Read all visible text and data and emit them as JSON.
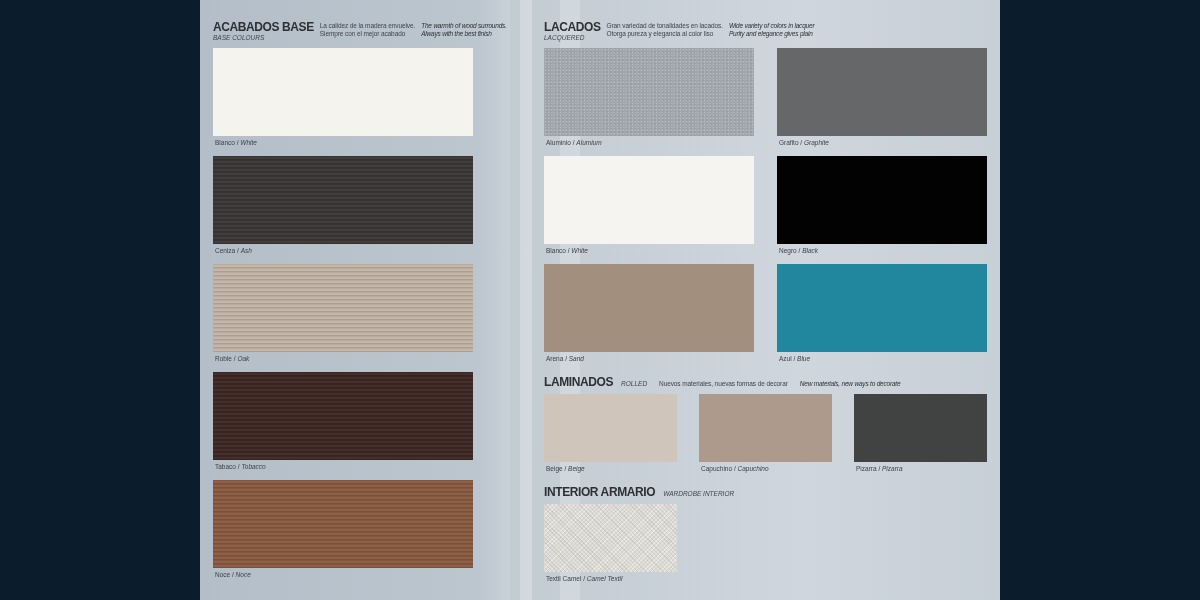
{
  "left_page": {
    "sections": [
      {
        "kind": "base",
        "title": "ACABADOS BASE",
        "subtitle": "BASE COLOURS",
        "description": [
          "La calidez de la madera envuelve.",
          "Siempre con el mejor acabado"
        ],
        "note": [
          "The warmth of wood surrounds.",
          "Always with the best finish"
        ],
        "swatches": [
          {
            "label": "Blanco / *White*",
            "kind": "solid",
            "color": "#f4f3ee"
          },
          {
            "label": "Ceniza / *Ash*",
            "kind": "wood",
            "color": "#3a3636"
          },
          {
            "label": "Roble / *Oak*",
            "kind": "wood",
            "color": "#c2b4a6"
          },
          {
            "label": "Tabaco / *Tobacco*",
            "kind": "wood",
            "color": "#3d2723"
          },
          {
            "label": "Noce / *Noce*",
            "kind": "wood",
            "color": "#8a5a41"
          }
        ]
      }
    ]
  },
  "right_page": {
    "sections": [
      {
        "kind": "lacquer",
        "title": "LACADOS",
        "subtitle": "LACQUERED",
        "description": [
          "Gran variedad de tonalidades en lacados.",
          "Otorga pureza y elegancia al color liso"
        ],
        "note": [
          "Wide variety of colors in lacquer",
          "Purity and elegance gives plain"
        ],
        "swatches": [
          {
            "label": "Aluminio / *Alumium*",
            "kind": "metallic",
            "color": "#a3a8ae"
          },
          {
            "label": "Grafito / *Graphite*",
            "kind": "solid",
            "color": "#666768"
          },
          {
            "label": "Blanco / *White*",
            "kind": "solid",
            "color": "#f5f4f0"
          },
          {
            "label": "Negro / *Black*",
            "kind": "solid",
            "color": "#020202"
          },
          {
            "label": "Arena / *Sand*",
            "kind": "solid",
            "color": "#a28f7d"
          },
          {
            "label": "Azul / *Blue*",
            "kind": "solid",
            "color": "#21879e"
          }
        ]
      },
      {
        "kind": "laminate",
        "title": "LAMINADOS",
        "subtitle": "ROLLED",
        "description": [
          "Nuevos materiales, nuevas formas de decorar"
        ],
        "note": [
          "New materials, new ways to decorate"
        ],
        "swatches": [
          {
            "label": "Beige / *Beige*",
            "kind": "solid",
            "color": "#d0c5ba"
          },
          {
            "label": "Capuchino / *Capuchino*",
            "kind": "solid",
            "color": "#ae9a8d"
          },
          {
            "label": "Pizarra / *Pizarra*",
            "kind": "solid",
            "color": "#414242"
          }
        ]
      },
      {
        "kind": "interior",
        "title": "INTERIOR ARMARIO",
        "subtitle": "WARDROBE INTERIOR",
        "swatches": [
          {
            "label": "Textil Camel / *Camel Textil*",
            "kind": "fabric",
            "color": "#dcdad4"
          }
        ]
      }
    ]
  }
}
